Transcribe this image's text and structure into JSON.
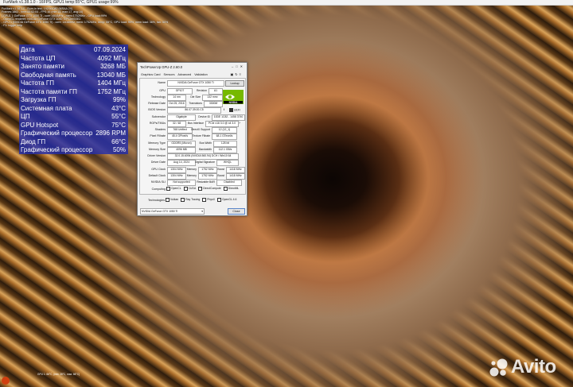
{
  "window": {
    "title": "FurMark v1.38.1.0 - 16FPS, GPU1 temp:55°C, GPU1 usage:99%"
  },
  "osd": {
    "lines": [
      "FurMark v1.38.1.0 - Burn-in test, 1920x1080 (MSAA 2X)",
      "Frames:1863 - time:00:02:04 - FPS:16 (min:14, max:17, avg:16)",
      "[ GPU1 ]: GeForce GTX 1050 Ti - core:1404MHz - mem:1752MHz - GPU load:99%",
      "- OpenGL renderer: NVIDIA GeForce GTX 1050 Ti/PCIe/SSE2",
      "- GPU 1 (NVIDIA GeForce GTX 1050 Ti) - core: 1404MHz, mem: 1752MHz, temp: 55°C, GPU load: 99%, mem load: 36%, fan: 50%",
      "- F1: toggle help"
    ]
  },
  "stats": [
    {
      "label": "Дата",
      "value": "07.09.2024",
      "label_color": "#ffffff",
      "value_color": "#ffffff"
    },
    {
      "label": "Частота ЦП",
      "value": "4092 МГц",
      "label_color": "#ffffff",
      "value_color": "#ffffff"
    },
    {
      "label": "Занято памяти",
      "value": "3268 МБ",
      "label_color": "#ffffff",
      "value_color": "#ffffff"
    },
    {
      "label": "Свободная память",
      "value": "13040 МБ",
      "label_color": "#ffffff",
      "value_color": "#ffffff"
    },
    {
      "label": "Частота ГП",
      "value": "1404 МГц",
      "label_color": "#ffffff",
      "value_color": "#ffffff"
    },
    {
      "label": "Частота памяти ГП",
      "value": "1752 МГц",
      "label_color": "#ffffff",
      "value_color": "#ffffff"
    },
    {
      "label": "Загрузка ГП",
      "value": "99%",
      "label_color": "#ffffff",
      "value_color": "#ffffff"
    },
    {
      "label": "Системная плата",
      "value": "43°C",
      "label_color": "#ffffff",
      "value_color": "#ffffff"
    },
    {
      "label": "ЦП",
      "value": "55°C",
      "label_color": "#ffffff",
      "value_color": "#ffffff"
    },
    {
      "label": "GPU Hotspot",
      "value": "75°C",
      "label_color": "#ffffff",
      "value_color": "#ffffff"
    },
    {
      "label": "Графический процессор",
      "value": "2896 RPM",
      "label_color": "#ffffff",
      "value_color": "#ffffff"
    },
    {
      "label": "Диод ГП",
      "value": "66°C",
      "label_color": "#ffffff",
      "value_color": "#ffffff"
    },
    {
      "label": "Графический процессор",
      "value": "50%",
      "label_color": "#ffffff",
      "value_color": "#ffffff"
    }
  ],
  "gpuz": {
    "title": "TechPowerUp GPU-Z 2.60.0",
    "tabs": [
      "Graphics Card",
      "Sensors",
      "Advanced",
      "Validation"
    ],
    "lookup": "Lookup",
    "uefi": "UEFI",
    "close": "Close",
    "selected_gpu": "NVIDIA GeForce GTX 1050 Ti",
    "fields": {
      "name": {
        "label": "Name",
        "value": "NVIDIA GeForce GTX 1050 Ti"
      },
      "gpu": {
        "label": "GPU",
        "value": "GP107"
      },
      "revision": {
        "label": "Revision",
        "value": "A1"
      },
      "technology": {
        "label": "Technology",
        "value": "14 nm"
      },
      "die_size": {
        "label": "Die Size",
        "value": "132 mm²"
      },
      "release_date": {
        "label": "Release Date",
        "value": "Oct 25, 2016"
      },
      "transistors": {
        "label": "Transistors",
        "value": "3300M"
      },
      "bios_version": {
        "label": "BIOS Version",
        "value": "86.07.39.00.C5"
      },
      "subvendor": {
        "label": "Subvendor",
        "value": "Gigabyte"
      },
      "device_id": {
        "label": "Device ID",
        "value": "10DE 1C82 - 1458 3740"
      },
      "rops_tmus": {
        "label": "ROPs/TMUs",
        "value": "32 / 48"
      },
      "bus_interface": {
        "label": "Bus Interface",
        "value": "PCIe x16 3.0 @ x4 3.0"
      },
      "shaders": {
        "label": "Shaders",
        "value": "768 Unified"
      },
      "directx": {
        "label": "DirectX Support",
        "value": "12 (12_1)"
      },
      "pixel_fillrate": {
        "label": "Pixel Fillrate",
        "value": "45.4 GPixel/s"
      },
      "texture_fillrate": {
        "label": "Texture Fillrate",
        "value": "68.1 GTexel/s"
      },
      "memory_type": {
        "label": "Memory Type",
        "value": "GDDR5 (Micron)"
      },
      "bus_width": {
        "label": "Bus Width",
        "value": "128 bit"
      },
      "memory_size": {
        "label": "Memory Size",
        "value": "4096 MB"
      },
      "bandwidth": {
        "label": "Bandwidth",
        "value": "112.1 GB/s"
      },
      "driver_version": {
        "label": "Driver Version",
        "value": "32.0.15.6094 (NVIDIA 560.94) DCH / Win10 64"
      },
      "driver_date": {
        "label": "Driver Date",
        "value": "Aug 14, 2024"
      },
      "digital_signature": {
        "label": "Digital Signature",
        "value": "WHQL"
      },
      "gpu_clock": {
        "label": "GPU Clock",
        "value": "1304 MHz"
      },
      "memory_clock": {
        "label": "Memory",
        "value": "1752 MHz"
      },
      "boost_clock": {
        "label": "Boost",
        "value": "1418 MHz"
      },
      "default_clock": {
        "label": "Default Clock",
        "value": "1304 MHz"
      },
      "default_memory": {
        "label": "Memory",
        "value": "1752 MHz"
      },
      "default_boost": {
        "label": "Boost",
        "value": "1418 MHz"
      },
      "nvidia_sli": {
        "label": "NVIDIA SLI",
        "value": "Not supported"
      },
      "resizable_bar": {
        "label": "Resizable BAR",
        "value": "Disabled"
      }
    },
    "computing": {
      "label": "Computing",
      "items": [
        "OpenCL",
        "CUDA",
        "DirectCompute",
        "DirectML"
      ]
    },
    "technologies": {
      "label": "Technologies",
      "items": [
        "Vulkan",
        "Ray Tracing",
        "PhysX",
        "OpenGL 4.6"
      ]
    }
  },
  "bottom": {
    "text": "GPU 1: 66°C, (min: 28°C, max: 66°C)"
  },
  "watermark": {
    "text": "Avito"
  }
}
